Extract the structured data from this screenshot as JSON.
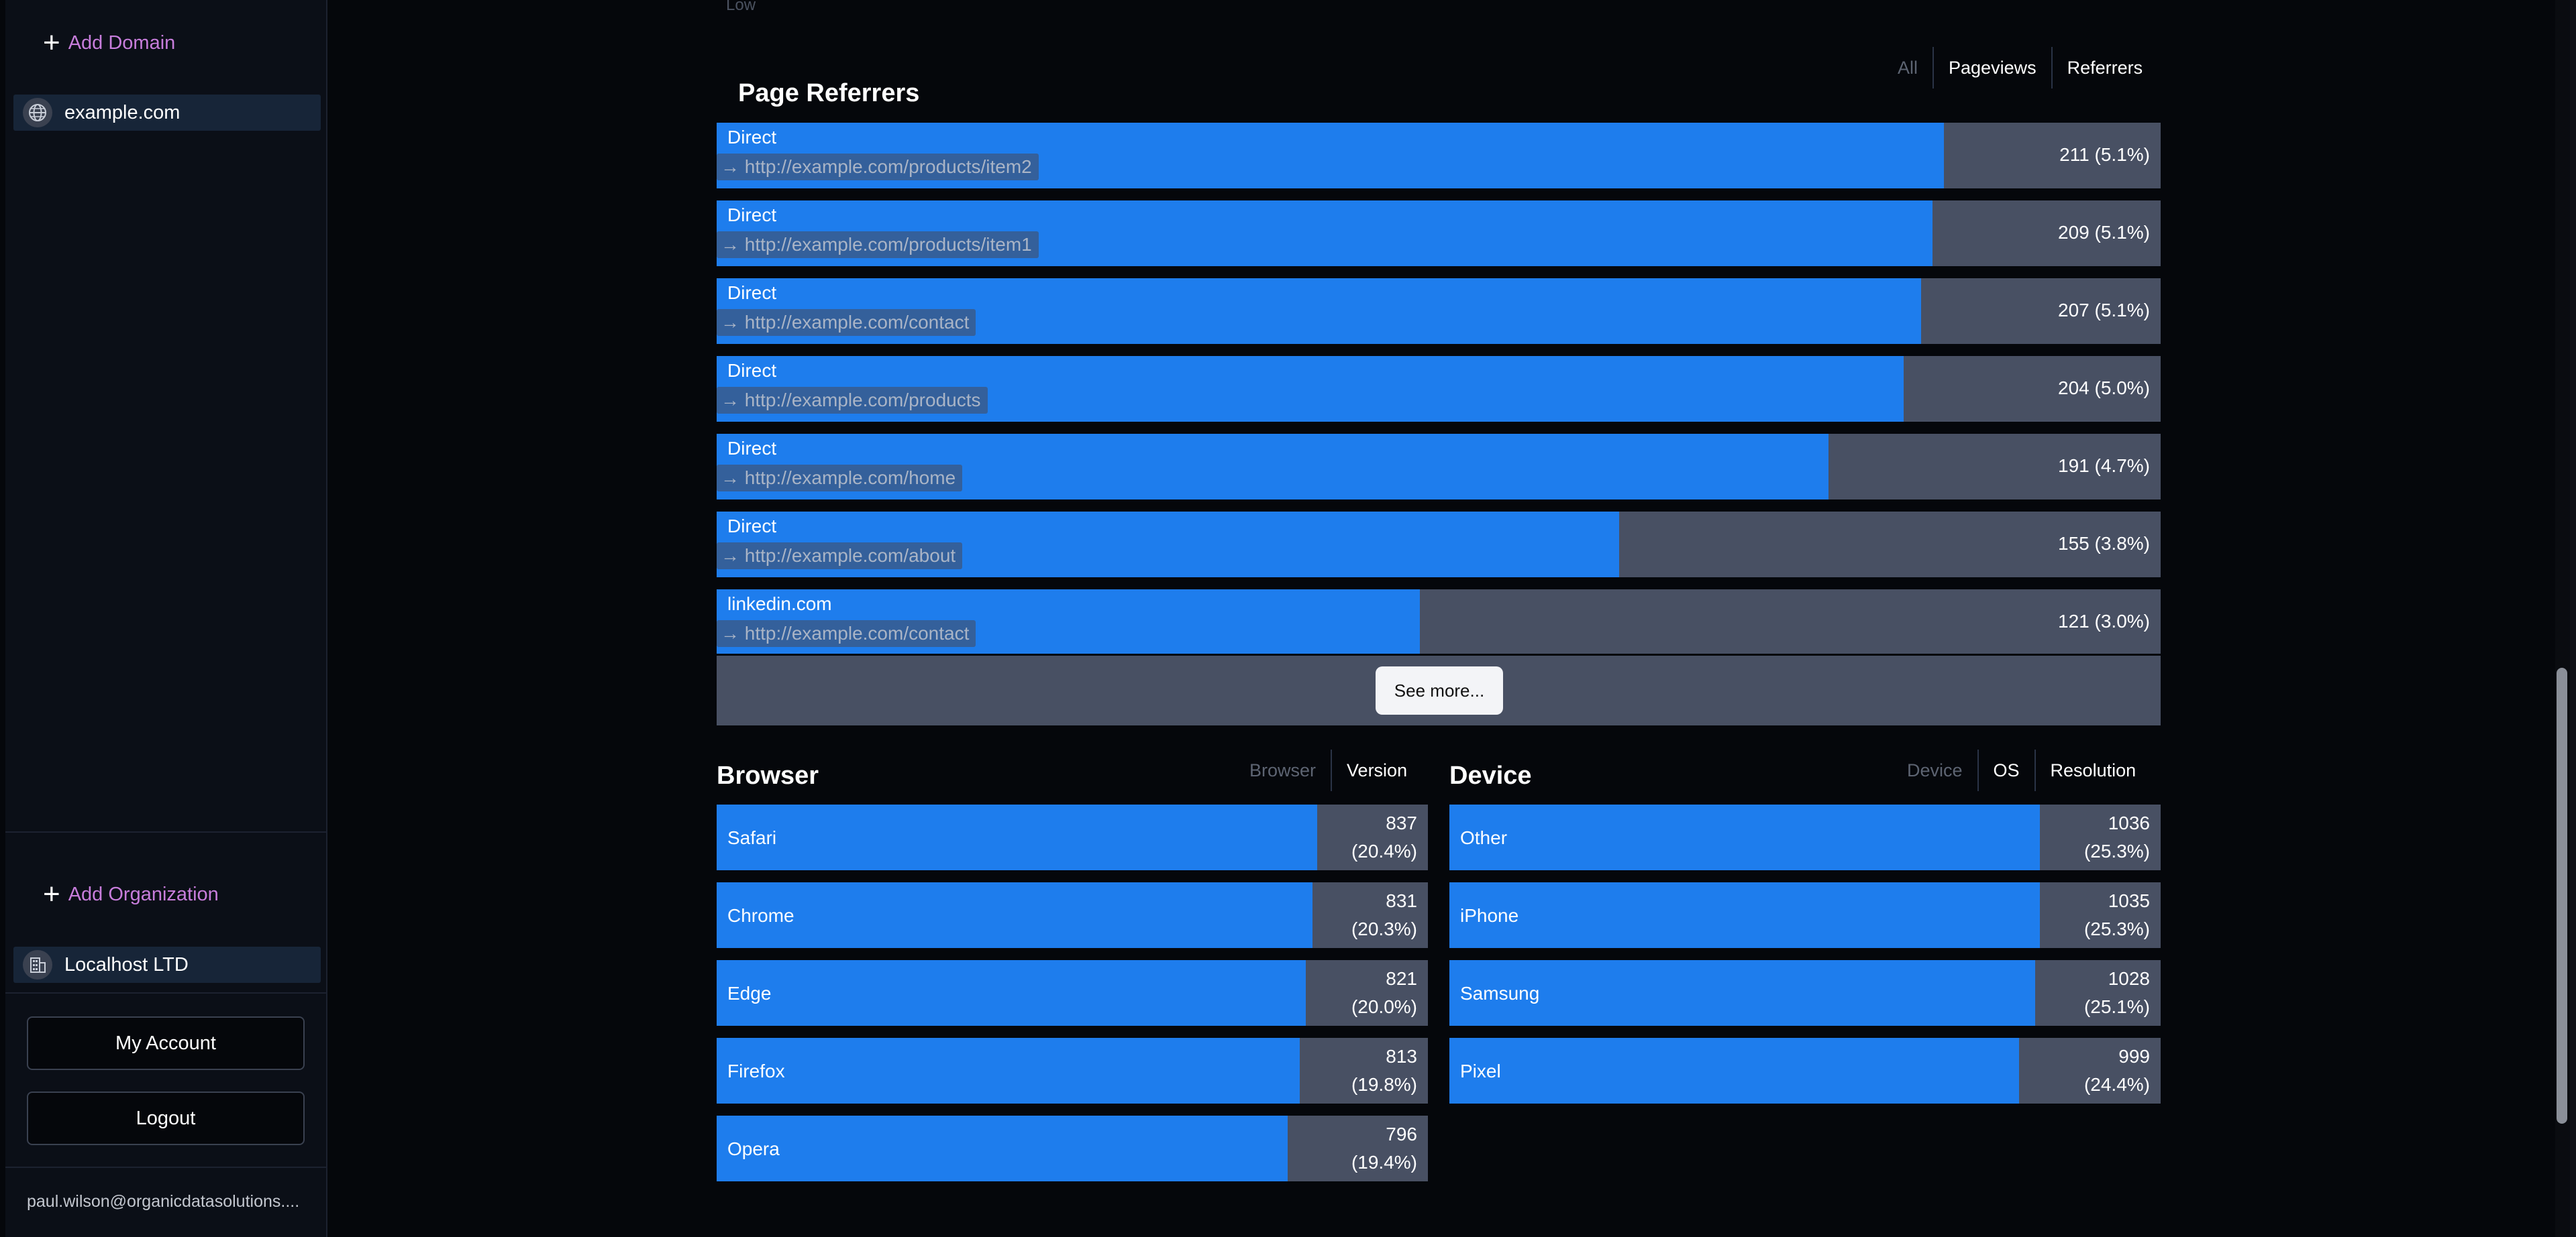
{
  "sidebar": {
    "add_domain": "Add Domain",
    "domain": "example.com",
    "add_organization": "Add Organization",
    "organization": "Localhost LTD",
    "my_account": "My Account",
    "logout": "Logout",
    "email": "paul.wilson@organicdatasolutions...."
  },
  "top_partial_label": "Low",
  "referrers": {
    "title": "Page Referrers",
    "tabs": [
      "All",
      "Pageviews",
      "Referrers"
    ],
    "rows": [
      {
        "source": "Direct",
        "target": "→ http://example.com/products/item2",
        "value": "211 (5.1%)",
        "share": 0.85
      },
      {
        "source": "Direct",
        "target": "→ http://example.com/products/item1",
        "value": "209 (5.1%)",
        "share": 0.842
      },
      {
        "source": "Direct",
        "target": "→ http://example.com/contact",
        "value": "207 (5.1%)",
        "share": 0.834
      },
      {
        "source": "Direct",
        "target": "→ http://example.com/products",
        "value": "204 (5.0%)",
        "share": 0.822
      },
      {
        "source": "Direct",
        "target": "→ http://example.com/home",
        "value": "191 (4.7%)",
        "share": 0.77
      },
      {
        "source": "Direct",
        "target": "→ http://example.com/about",
        "value": "155 (3.8%)",
        "share": 0.625
      },
      {
        "source": "linkedin.com",
        "target": "→ http://example.com/contact",
        "value": "121 (3.0%)",
        "share": 0.487
      }
    ],
    "see_more": "See more..."
  },
  "browser": {
    "title": "Browser",
    "tabs": [
      "Browser",
      "Version"
    ],
    "rows": [
      {
        "label": "Safari",
        "count": "837",
        "pct": "(20.4%)",
        "share": 0.844
      },
      {
        "label": "Chrome",
        "count": "831",
        "pct": "(20.3%)",
        "share": 0.838
      },
      {
        "label": "Edge",
        "count": "821",
        "pct": "(20.0%)",
        "share": 0.828
      },
      {
        "label": "Firefox",
        "count": "813",
        "pct": "(19.8%)",
        "share": 0.82
      },
      {
        "label": "Opera",
        "count": "796",
        "pct": "(19.4%)",
        "share": 0.803
      }
    ]
  },
  "device": {
    "title": "Device",
    "tabs": [
      "Device",
      "OS",
      "Resolution"
    ],
    "rows": [
      {
        "label": "Other",
        "count": "1036",
        "pct": "(25.3%)",
        "share": 0.83
      },
      {
        "label": "iPhone",
        "count": "1035",
        "pct": "(25.3%)",
        "share": 0.83
      },
      {
        "label": "Samsung",
        "count": "1028",
        "pct": "(25.1%)",
        "share": 0.824
      },
      {
        "label": "Pixel",
        "count": "999",
        "pct": "(24.4%)",
        "share": 0.801
      }
    ]
  }
}
